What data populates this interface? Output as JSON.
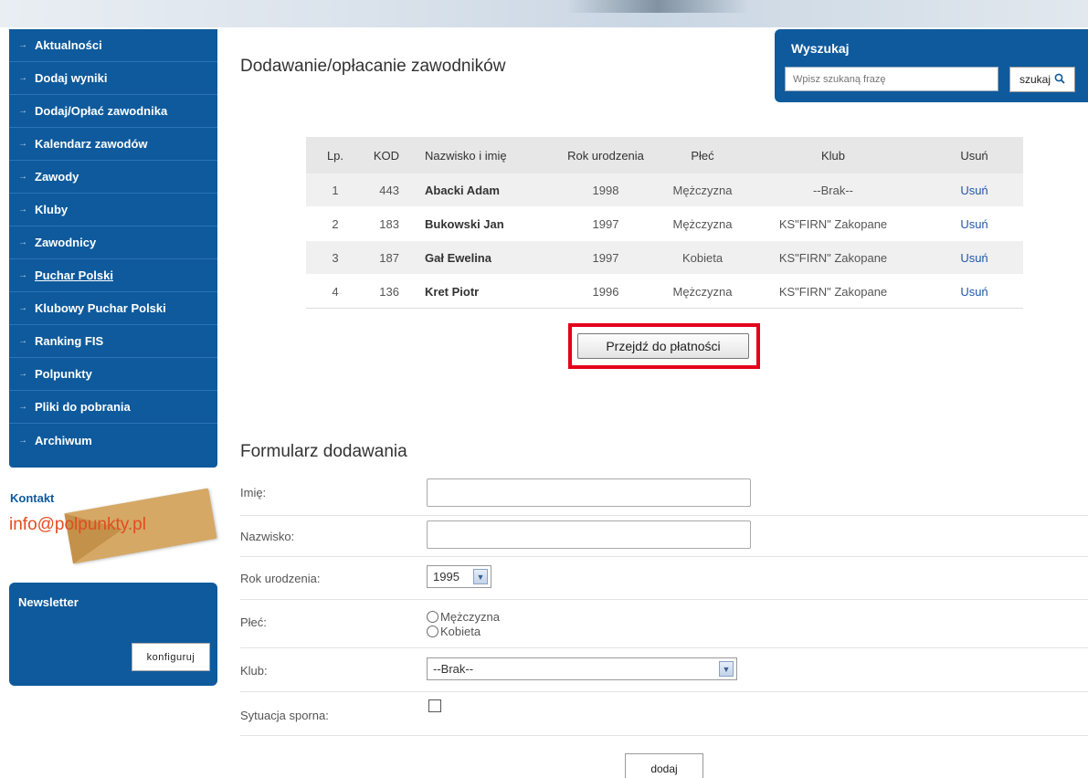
{
  "sidebar": {
    "items": [
      {
        "label": "Aktualności"
      },
      {
        "label": "Dodaj wyniki"
      },
      {
        "label": "Dodaj/Opłać zawodnika"
      },
      {
        "label": "Kalendarz zawodów"
      },
      {
        "label": "Zawody"
      },
      {
        "label": "Kluby"
      },
      {
        "label": "Zawodnicy"
      },
      {
        "label": "Puchar Polski"
      },
      {
        "label": "Klubowy Puchar Polski"
      },
      {
        "label": "Ranking FIS"
      },
      {
        "label": "Polpunkty"
      },
      {
        "label": "Pliki do pobrania"
      },
      {
        "label": "Archiwum"
      }
    ],
    "arrow_glyph": "→"
  },
  "contact": {
    "title": "Kontakt",
    "email": "info@polpunkty.pl"
  },
  "newsletter": {
    "title": "Newsletter",
    "button": "konfiguruj"
  },
  "search": {
    "title": "Wyszukaj",
    "placeholder": "Wpisz szukaną frazę",
    "button": "szukaj"
  },
  "page": {
    "title": "Dodawanie/opłacanie zawodników"
  },
  "table": {
    "headers": {
      "lp": "Lp.",
      "kod": "KOD",
      "name": "Nazwisko i imię",
      "year": "Rok urodzenia",
      "sex": "Płeć",
      "club": "Klub",
      "remove": "Usuń"
    },
    "rows": [
      {
        "lp": "1",
        "kod": "443",
        "name": "Abacki Adam",
        "year": "1998",
        "sex": "Mężczyzna",
        "club": "--Brak--",
        "remove": "Usuń"
      },
      {
        "lp": "2",
        "kod": "183",
        "name": "Bukowski Jan",
        "year": "1997",
        "sex": "Mężczyzna",
        "club": "KS\"FIRN\" Zakopane",
        "remove": "Usuń"
      },
      {
        "lp": "3",
        "kod": "187",
        "name": "Gał Ewelina",
        "year": "1997",
        "sex": "Kobieta",
        "club": "KS\"FIRN\" Zakopane",
        "remove": "Usuń"
      },
      {
        "lp": "4",
        "kod": "136",
        "name": "Kret Piotr",
        "year": "1996",
        "sex": "Mężczyzna",
        "club": "KS\"FIRN\" Zakopane",
        "remove": "Usuń"
      }
    ]
  },
  "pay_button": "Przejdź do płatności",
  "form": {
    "title": "Formularz dodawania",
    "first_name_label": "Imię:",
    "last_name_label": "Nazwisko:",
    "birth_year_label": "Rok urodzenia:",
    "birth_year_value": "1995",
    "sex_label": "Płeć:",
    "sex_option_male": "Mężczyzna",
    "sex_option_female": "Kobieta",
    "club_label": "Klub:",
    "club_value": "--Brak--",
    "dispute_label": "Sytuacja sporna:",
    "submit": "dodaj"
  },
  "colors": {
    "brand_blue": "#0e5a9c",
    "link_blue": "#1f57a8",
    "highlight_red": "#e3001b",
    "email_orange": "#e24c1f"
  }
}
